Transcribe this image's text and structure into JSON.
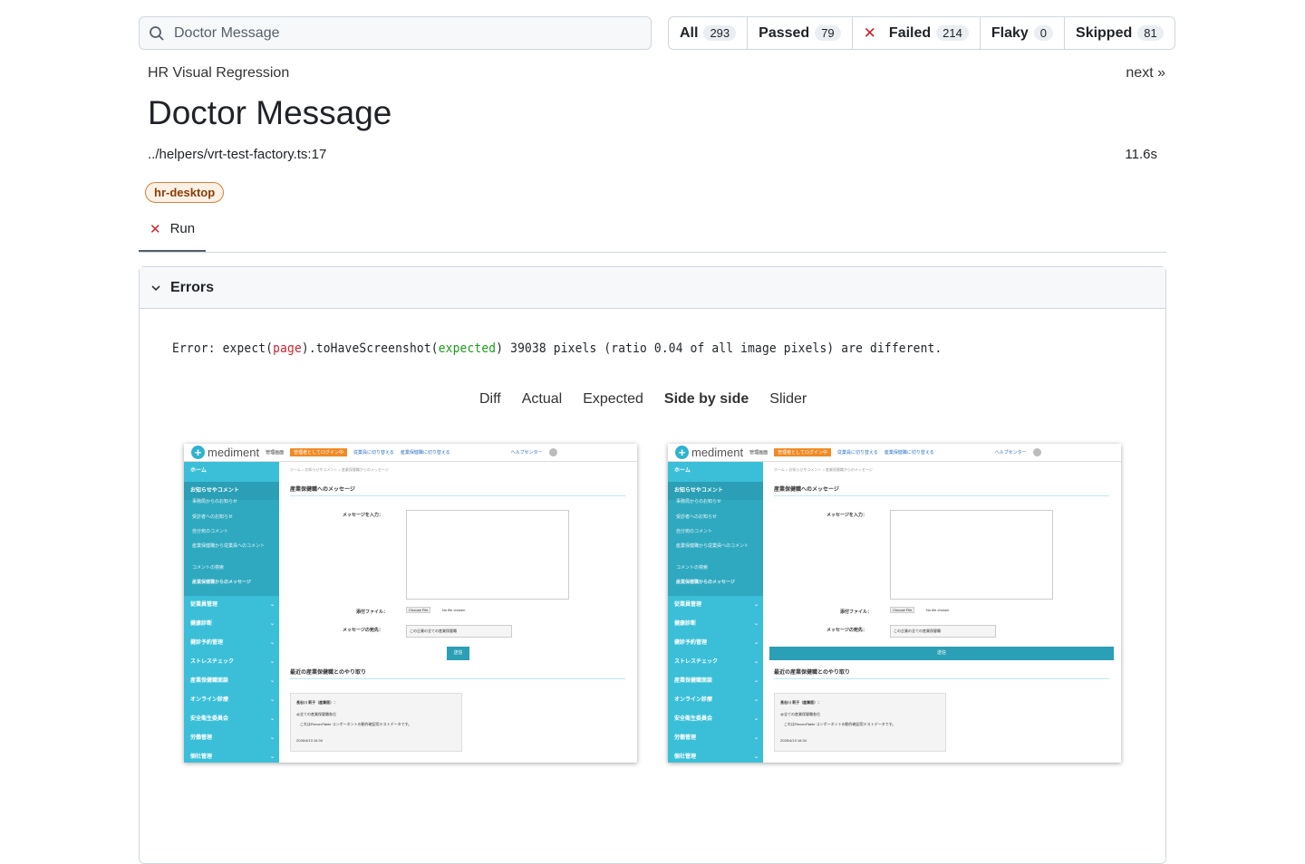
{
  "search": {
    "value": "Doctor Message"
  },
  "filters": [
    {
      "label": "All",
      "count": "293"
    },
    {
      "label": "Passed",
      "count": "79"
    },
    {
      "label": "Failed",
      "count": "214"
    },
    {
      "label": "Flaky",
      "count": "0"
    },
    {
      "label": "Skipped",
      "count": "81"
    }
  ],
  "header": {
    "project": "HR Visual Regression",
    "next": "next »",
    "title": "Doctor Message",
    "location": "../helpers/vrt-test-factory.ts:17",
    "duration": "11.6s",
    "tag": "hr-desktop",
    "run_tab": "Run"
  },
  "errors": {
    "title": "Errors",
    "msg_prefix": "Error: expect(",
    "msg_page": "page",
    "msg_mid": ").toHaveScreenshot(",
    "msg_expected": "expected",
    "msg_suffix": ") 39038 pixels (ratio 0.04 of all image pixels) are different."
  },
  "view_tabs": [
    "Diff",
    "Actual",
    "Expected",
    "Side by side",
    "Slider"
  ],
  "selected_view": "Side by side",
  "screenshot": {
    "logo": "mediment",
    "header_items": [
      "管理画面",
      "管理者としてログイン中",
      "従業員に切り替える",
      "産業保健職に切り替える",
      "ヘルプセンター"
    ],
    "sidebar_top": "ホーム",
    "sidebar_group": "お知らせやコメント",
    "sidebar_sub": [
      "事務局からのお知らせ",
      "受診者へのお知らせ",
      "自分宛のコメント",
      "産業保健職から従業員へのコメント",
      "コメントの検索",
      "産業保健職からのメッセージ"
    ],
    "sidebar_items": [
      "従業員管理",
      "健康診断",
      "健診予約管理",
      "ストレスチェック",
      "産業保健職面談",
      "オンライン診療",
      "安全衛生委員会",
      "労働管理",
      "個社管理"
    ],
    "breadcrumb": "ホーム > お知らせやコメント > 産業保健職からのメッセージ",
    "heading": "産業保健職へのメッセージ",
    "message_label": "メッセージを入力：",
    "file_label": "添付ファイル：",
    "choose_file": "Choose File",
    "no_file": "No file chosen",
    "dest_label": "メッセージの宛先：",
    "dest_value": "この企業の全ての産業保健職",
    "send": "送信",
    "recent_heading": "最近の産業保健職とのやり取り",
    "card_name": "長谷川 莉子（産業医）：",
    "card_to": "@全ての産業保健職各位",
    "card_body": "これはRecordTable コンポーネントの動作確認用テストデータです。",
    "card_date": "2026/4/13 16:34"
  }
}
